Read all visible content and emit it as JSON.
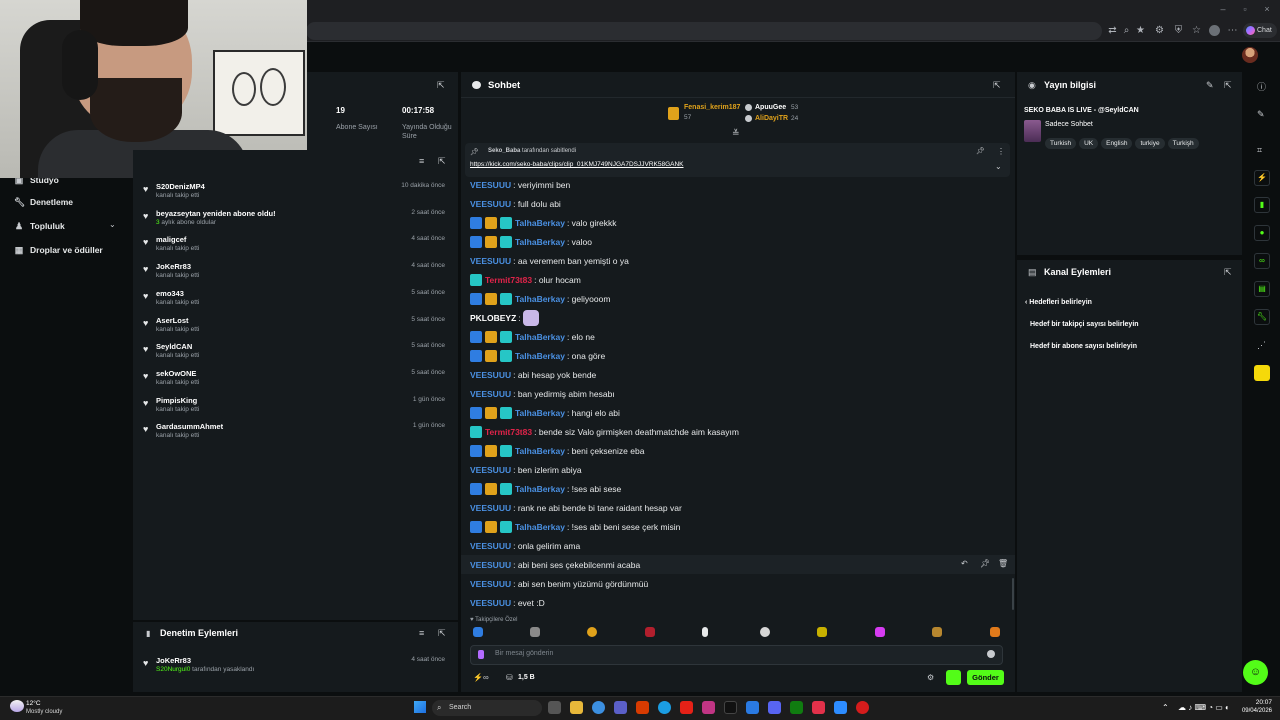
{
  "browser": {
    "chat_chip": "Chat",
    "icons": [
      "translate-icon",
      "zoom-icon",
      "bookmark-star-icon",
      "extensions-icon",
      "tab-search-icon",
      "adblock-icon",
      "favorites-icon",
      "collections-icon",
      "profile-icon"
    ]
  },
  "stats": {
    "subs_value": "19",
    "subs_label": "Abone Sayısı",
    "uptime_value": "00:17:58",
    "uptime_label": "Yayında Olduğu Süre"
  },
  "nav": {
    "studio": "Stüdyo",
    "moderation": "Denetleme",
    "community": "Topluluk",
    "drops": "Droplar ve ödüller"
  },
  "activity": [
    {
      "name": "S20DenizMP4",
      "sub": "kanalı takip etti",
      "time": "10 dakika önce"
    },
    {
      "name": "beyazseytan yeniden abone oldu!",
      "sub_green": "3",
      "sub": " aylık abone oldular",
      "time": "2 saat önce"
    },
    {
      "name": "maligcef",
      "sub": "kanalı takip etti",
      "time": "4 saat önce"
    },
    {
      "name": "JoKeRr83",
      "sub": "kanalı takip etti",
      "time": "4 saat önce"
    },
    {
      "name": "emo343",
      "sub": "kanalı takip etti",
      "time": "5 saat önce"
    },
    {
      "name": "AserLost",
      "sub": "kanalı takip etti",
      "time": "5 saat önce"
    },
    {
      "name": "SeyldCAN",
      "sub": "kanalı takip etti",
      "time": "5 saat önce"
    },
    {
      "name": "sekOwONE",
      "sub": "kanalı takip etti",
      "time": "5 saat önce"
    },
    {
      "name": "PimpisKing",
      "sub": "kanalı takip etti",
      "time": "1 gün önce"
    },
    {
      "name": "GardasummAhmet",
      "sub": "kanalı takip etti",
      "time": "1 gün önce"
    }
  ],
  "moderation": {
    "title": "Denetim Eylemleri",
    "row_name": "JoKeRr83",
    "row_actor": "S20Nurgul0",
    "row_sub": " tarafından yasaklandı",
    "row_time": "4 saat önce"
  },
  "chat": {
    "title": "Sohbet",
    "gifters": [
      {
        "name": "Fenasi_kerim187",
        "count": "57"
      },
      {
        "name": "ApuuGee",
        "count": "53"
      },
      {
        "name": "AliDayiTR",
        "count": "24"
      }
    ],
    "pinned_by": "Seko_Baba",
    "pinned_suffix": " tarafından sabitlendi",
    "pinned_link": "https://kick.com/seko-baba/clips/clip_01KMJ749NJGA7DSJJVRK58GANK",
    "messages": [
      {
        "user": "VEESUUU",
        "text": ": veriyimmi ben",
        "color": "#4a90e2",
        "badges": 0
      },
      {
        "user": "VEESUUU",
        "text": ": full dolu abi",
        "color": "#4a90e2",
        "badges": 0
      },
      {
        "user": "TalhaBerkay",
        "text": ": valo girekkk",
        "color": "#4a90e2",
        "badges": 3
      },
      {
        "user": "TalhaBerkay",
        "text": ": valoo",
        "color": "#4a90e2",
        "badges": 3
      },
      {
        "user": "VEESUUU",
        "text": ": aa veremem ban yemişti o ya",
        "color": "#4a90e2",
        "badges": 0
      },
      {
        "user": "Termit73t83",
        "text": ": olur hocam",
        "color": "#e0244a",
        "badges": 1
      },
      {
        "user": "TalhaBerkay",
        "text": ": geliyooom",
        "color": "#4a90e2",
        "badges": 3
      },
      {
        "user": "PKLOBEYZ",
        "text": ":",
        "color": "#ffffff",
        "badges": 0,
        "emote": true
      },
      {
        "user": "TalhaBerkay",
        "text": ": elo ne",
        "color": "#4a90e2",
        "badges": 3
      },
      {
        "user": "TalhaBerkay",
        "text": ": ona göre",
        "color": "#4a90e2",
        "badges": 3
      },
      {
        "user": "VEESUUU",
        "text": ": abi hesap yok bende",
        "color": "#4a90e2",
        "badges": 0
      },
      {
        "user": "VEESUUU",
        "text": ": ban yedirmiş abim hesabı",
        "color": "#4a90e2",
        "badges": 0
      },
      {
        "user": "TalhaBerkay",
        "text": ": hangi elo abi",
        "color": "#4a90e2",
        "badges": 3
      },
      {
        "user": "Termit73t83",
        "text": ": bende siz Valo girmişken deathmatchde aim kasayım",
        "color": "#e0244a",
        "badges": 1
      },
      {
        "user": "TalhaBerkay",
        "text": ": beni çeksenize eba",
        "color": "#4a90e2",
        "badges": 3
      },
      {
        "user": "VEESUUU",
        "text": ": ben izlerim abiya",
        "color": "#4a90e2",
        "badges": 0
      },
      {
        "user": "TalhaBerkay",
        "text": ": !ses abi sese",
        "color": "#4a90e2",
        "badges": 3
      },
      {
        "user": "VEESUUU",
        "text": ": rank ne abi bende bi tane raidant hesap var",
        "color": "#4a90e2",
        "badges": 0
      },
      {
        "user": "TalhaBerkay",
        "text": ": !ses abi beni sese çerk misin",
        "color": "#4a90e2",
        "badges": 3
      },
      {
        "user": "VEESUUU",
        "text": ": onla gelirim ama",
        "color": "#4a90e2",
        "badges": 0
      },
      {
        "user": "VEESUUU",
        "text": ": abi beni ses çekebilcenmi acaba",
        "color": "#4a90e2",
        "badges": 0
      },
      {
        "user": "VEESUUU",
        "text": ": abi sen benim yüzümü gördünmüü",
        "color": "#4a90e2",
        "badges": 0
      },
      {
        "user": "VEESUUU",
        "text": ": evet :D",
        "color": "#4a90e2",
        "badges": 0
      }
    ],
    "followers_only": "Takipçilere Özel",
    "input_placeholder": "Bir mesaj gönderin",
    "points": "1,5 B",
    "send": "Gönder"
  },
  "info": {
    "title": "Yayın bilgisi",
    "stream_title": "SEKO BABA IS LIVE - @SeyldCAN",
    "category": "Sadece Sohbet",
    "tags": [
      "Turkish",
      "UK",
      "English",
      "turkiye",
      "Turkişh"
    ]
  },
  "actions": {
    "title": "Kanal Eylemleri",
    "back": "Hedefleri belirleyin",
    "goal_followers": "Hedef bir takipçi sayısı belirleyin",
    "goal_subs": "Hedef bir abone sayısı belirleyin"
  },
  "taskbar": {
    "search": "Search",
    "weather_temp": "12°C",
    "weather_desc": "Mostly cloudy",
    "time": "20:07",
    "date": "09/04/2026"
  },
  "colors": {
    "accent": "#53fc18",
    "panel": "#151a1d",
    "bg": "#0b0e0f"
  }
}
